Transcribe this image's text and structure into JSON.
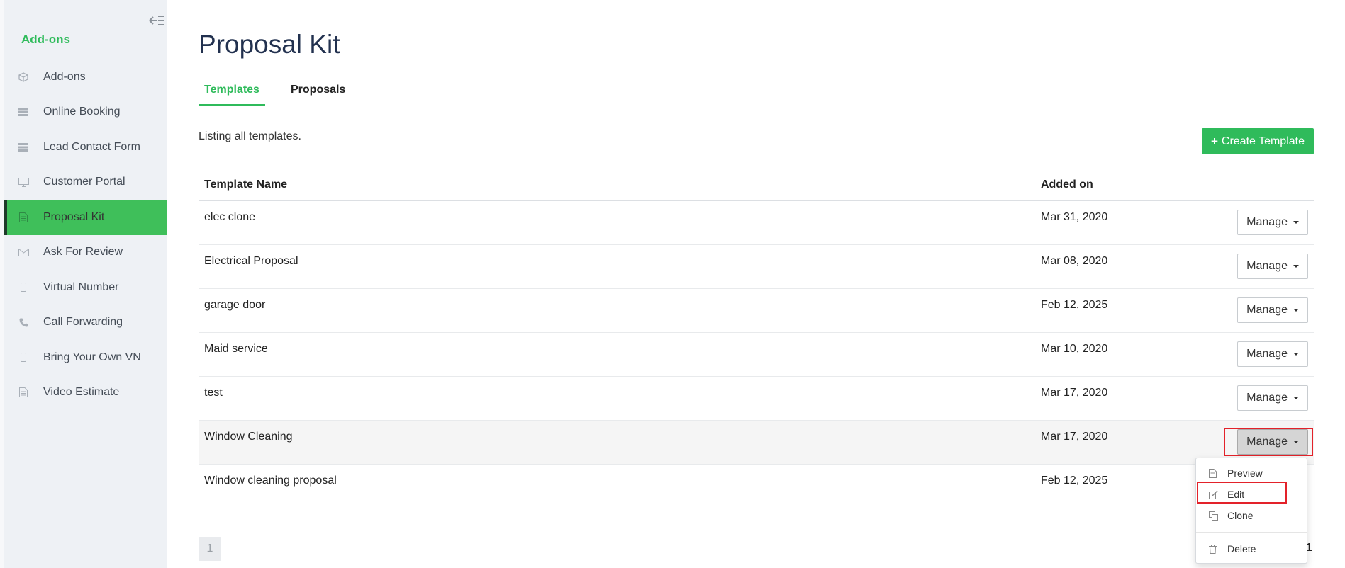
{
  "sidebar": {
    "title": "Add-ons",
    "items": [
      {
        "label": "Add-ons",
        "icon": "cube-icon"
      },
      {
        "label": "Online Booking",
        "icon": "server-icon"
      },
      {
        "label": "Lead Contact Form",
        "icon": "server-icon"
      },
      {
        "label": "Customer Portal",
        "icon": "monitor-icon"
      },
      {
        "label": "Proposal Kit",
        "icon": "document-icon",
        "active": true
      },
      {
        "label": "Ask For Review",
        "icon": "envelope-icon"
      },
      {
        "label": "Virtual Number",
        "icon": "mobile-icon"
      },
      {
        "label": "Call Forwarding",
        "icon": "phone-icon"
      },
      {
        "label": "Bring Your Own VN",
        "icon": "mobile-icon"
      },
      {
        "label": "Video Estimate",
        "icon": "document-icon"
      }
    ]
  },
  "page": {
    "title": "Proposal Kit",
    "tabs": [
      "Templates",
      "Proposals"
    ],
    "listing_text": "Listing all templates.",
    "create_button": "Create Template"
  },
  "table": {
    "headers": [
      "Template Name",
      "Added on"
    ],
    "rows": [
      {
        "name": "elec clone",
        "date": "Mar 31, 2020"
      },
      {
        "name": "Electrical Proposal",
        "date": "Mar 08, 2020"
      },
      {
        "name": "garage door",
        "date": "Feb 12, 2025"
      },
      {
        "name": "Maid service",
        "date": "Mar 10, 2020"
      },
      {
        "name": "test",
        "date": "Mar 17, 2020"
      },
      {
        "name": "Window Cleaning",
        "date": "Mar 17, 2020"
      },
      {
        "name": "Window cleaning proposal",
        "date": "Feb 12, 2025"
      }
    ],
    "manage_label": "Manage"
  },
  "dropdown": {
    "items": [
      "Preview",
      "Edit",
      "Clone",
      "Delete"
    ]
  },
  "pagination": {
    "current": "1",
    "last": "1"
  },
  "colors": {
    "accent": "#2fbb5b",
    "highlight": "#e3222a"
  }
}
